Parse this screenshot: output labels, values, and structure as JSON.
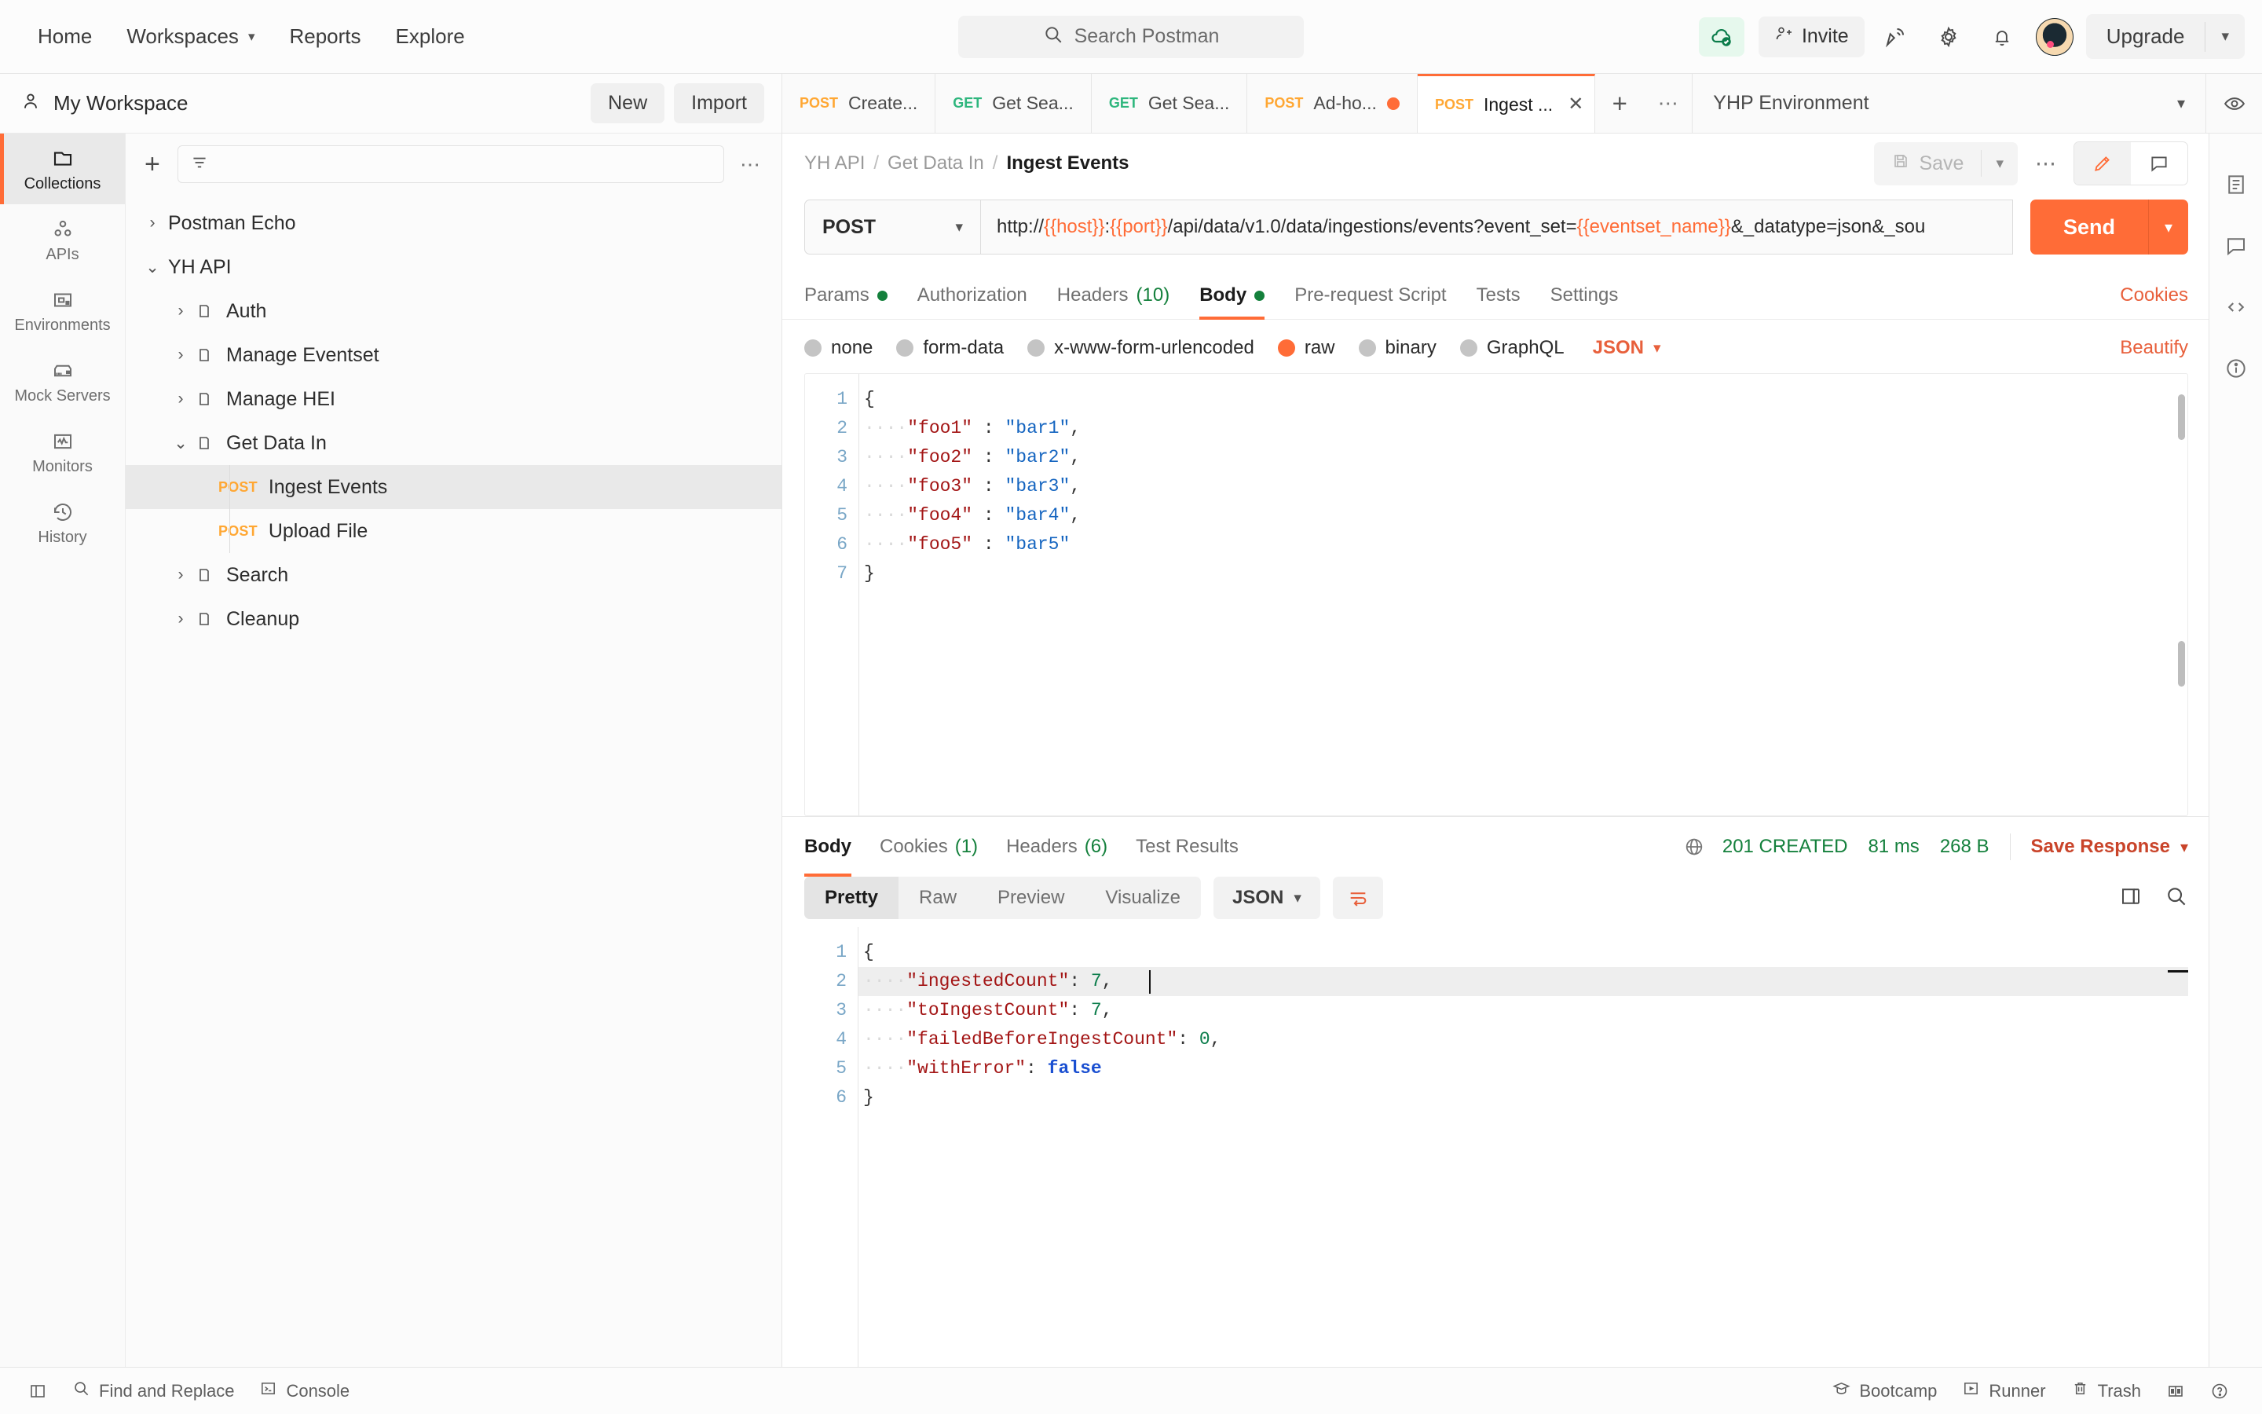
{
  "topbar": {
    "nav": [
      {
        "label": "Home",
        "caret": false
      },
      {
        "label": "Workspaces",
        "caret": true
      },
      {
        "label": "Reports",
        "caret": false
      },
      {
        "label": "Explore",
        "caret": false
      }
    ],
    "search_placeholder": "Search Postman",
    "invite_label": "Invite",
    "upgrade_label": "Upgrade",
    "icons": [
      "cloud-sync-icon",
      "invite-icon",
      "satellite-icon",
      "gear-icon",
      "bell-icon",
      "avatar",
      "chevron-down-icon"
    ]
  },
  "workspace": {
    "name": "My Workspace",
    "new_label": "New",
    "import_label": "Import"
  },
  "rail": {
    "items": [
      {
        "label": "Collections",
        "icon": "folder-icon",
        "active": true
      },
      {
        "label": "APIs",
        "icon": "api-nodes-icon",
        "active": false
      },
      {
        "label": "Environments",
        "icon": "environment-icon",
        "active": false
      },
      {
        "label": "Mock Servers",
        "icon": "mock-server-icon",
        "active": false
      },
      {
        "label": "Monitors",
        "icon": "monitor-pulse-icon",
        "active": false
      },
      {
        "label": "History",
        "icon": "history-clock-icon",
        "active": false
      }
    ]
  },
  "sidebar": {
    "filter_placeholder": "",
    "tree": [
      {
        "label": "Postman Echo",
        "type": "collection",
        "depth": 1,
        "expanded": false,
        "selected": false
      },
      {
        "label": "YH API",
        "type": "collection",
        "depth": 1,
        "expanded": true,
        "selected": false
      },
      {
        "label": "Auth",
        "type": "folder",
        "depth": 2,
        "expanded": false,
        "selected": false
      },
      {
        "label": "Manage Eventset",
        "type": "folder",
        "depth": 2,
        "expanded": false,
        "selected": false
      },
      {
        "label": "Manage HEI",
        "type": "folder",
        "depth": 2,
        "expanded": false,
        "selected": false
      },
      {
        "label": "Get Data In",
        "type": "folder",
        "depth": 2,
        "expanded": true,
        "selected": false
      },
      {
        "label": "Ingest Events",
        "type": "request",
        "method": "POST",
        "depth": 3,
        "selected": true
      },
      {
        "label": "Upload File",
        "type": "request",
        "method": "POST",
        "depth": 3,
        "selected": false
      },
      {
        "label": "Search",
        "type": "folder",
        "depth": 2,
        "expanded": false,
        "selected": false
      },
      {
        "label": "Cleanup",
        "type": "folder",
        "depth": 2,
        "expanded": false,
        "selected": false
      }
    ]
  },
  "tabs": {
    "items": [
      {
        "method": "POST",
        "label": "Create...",
        "active": false,
        "unsaved": false
      },
      {
        "method": "GET",
        "label": "Get Sea...",
        "active": false,
        "unsaved": false
      },
      {
        "method": "GET",
        "label": "Get Sea...",
        "active": false,
        "unsaved": false
      },
      {
        "method": "POST",
        "label": "Ad-ho...",
        "active": false,
        "unsaved": true
      },
      {
        "method": "POST",
        "label": "Ingest ...",
        "active": true,
        "unsaved": false
      }
    ],
    "environment": "YHP Environment"
  },
  "breadcrumb": {
    "parts": [
      "YH API",
      "Get Data In"
    ],
    "current": "Ingest Events",
    "save_label": "Save"
  },
  "request": {
    "method": "POST",
    "url_prefix": "http://",
    "url_parts": [
      {
        "text": "http://",
        "var": false
      },
      {
        "text": "{{host}}",
        "var": true
      },
      {
        "text": ":",
        "var": false
      },
      {
        "text": "{{port}}",
        "var": true
      },
      {
        "text": "/api/data/v1.0/data/ingestions/events?event_set=",
        "var": false
      },
      {
        "text": "{{eventset_name}}",
        "var": true
      },
      {
        "text": "&_datatype=json&_sou",
        "var": false
      }
    ],
    "send_label": "Send",
    "tabs": [
      {
        "label": "Params",
        "dot": true,
        "count": null,
        "active": false
      },
      {
        "label": "Authorization",
        "dot": false,
        "count": null,
        "active": false
      },
      {
        "label": "Headers",
        "dot": false,
        "count": "(10)",
        "active": false
      },
      {
        "label": "Body",
        "dot": true,
        "count": null,
        "active": true
      },
      {
        "label": "Pre-request Script",
        "dot": false,
        "count": null,
        "active": false
      },
      {
        "label": "Tests",
        "dot": false,
        "count": null,
        "active": false
      },
      {
        "label": "Settings",
        "dot": false,
        "count": null,
        "active": false
      }
    ],
    "cookies_label": "Cookies",
    "body_modes": [
      {
        "label": "none",
        "selected": false
      },
      {
        "label": "form-data",
        "selected": false
      },
      {
        "label": "x-www-form-urlencoded",
        "selected": false
      },
      {
        "label": "raw",
        "selected": true
      },
      {
        "label": "binary",
        "selected": false
      },
      {
        "label": "GraphQL",
        "selected": false
      }
    ],
    "body_format": "JSON",
    "beautify_label": "Beautify",
    "body_lines": [
      {
        "n": 1,
        "tokens": [
          {
            "t": "{",
            "c": "p"
          }
        ]
      },
      {
        "n": 2,
        "tokens": [
          {
            "t": "····",
            "c": "ws"
          },
          {
            "t": "\"foo1\"",
            "c": "k"
          },
          {
            "t": " : ",
            "c": "p"
          },
          {
            "t": "\"bar1\"",
            "c": "s"
          },
          {
            "t": ",",
            "c": "p"
          }
        ]
      },
      {
        "n": 3,
        "tokens": [
          {
            "t": "····",
            "c": "ws"
          },
          {
            "t": "\"foo2\"",
            "c": "k"
          },
          {
            "t": " : ",
            "c": "p"
          },
          {
            "t": "\"bar2\"",
            "c": "s"
          },
          {
            "t": ",",
            "c": "p"
          }
        ]
      },
      {
        "n": 4,
        "tokens": [
          {
            "t": "····",
            "c": "ws"
          },
          {
            "t": "\"foo3\"",
            "c": "k"
          },
          {
            "t": " : ",
            "c": "p"
          },
          {
            "t": "\"bar3\"",
            "c": "s"
          },
          {
            "t": ",",
            "c": "p"
          }
        ]
      },
      {
        "n": 5,
        "tokens": [
          {
            "t": "····",
            "c": "ws"
          },
          {
            "t": "\"foo4\"",
            "c": "k"
          },
          {
            "t": " : ",
            "c": "p"
          },
          {
            "t": "\"bar4\"",
            "c": "s"
          },
          {
            "t": ",",
            "c": "p"
          }
        ]
      },
      {
        "n": 6,
        "tokens": [
          {
            "t": "····",
            "c": "ws"
          },
          {
            "t": "\"foo5\"",
            "c": "k"
          },
          {
            "t": " : ",
            "c": "p"
          },
          {
            "t": "\"bar5\"",
            "c": "s"
          }
        ]
      },
      {
        "n": 7,
        "tokens": [
          {
            "t": "}",
            "c": "p"
          }
        ]
      }
    ]
  },
  "response": {
    "tabs": [
      {
        "label": "Body",
        "count": null,
        "active": true
      },
      {
        "label": "Cookies",
        "count": "(1)",
        "active": false
      },
      {
        "label": "Headers",
        "count": "(6)",
        "active": false
      },
      {
        "label": "Test Results",
        "count": null,
        "active": false
      }
    ],
    "status": "201 CREATED",
    "time": "81 ms",
    "size": "268 B",
    "save_response_label": "Save Response",
    "view_modes": [
      {
        "label": "Pretty",
        "active": true
      },
      {
        "label": "Raw",
        "active": false
      },
      {
        "label": "Preview",
        "active": false
      },
      {
        "label": "Visualize",
        "active": false
      }
    ],
    "format": "JSON",
    "body_lines": [
      {
        "n": 1,
        "tokens": [
          {
            "t": "{",
            "c": "p"
          }
        ]
      },
      {
        "n": 2,
        "tokens": [
          {
            "t": "····",
            "c": "ws"
          },
          {
            "t": "\"ingestedCount\"",
            "c": "k"
          },
          {
            "t": ": ",
            "c": "p"
          },
          {
            "t": "7",
            "c": "n"
          },
          {
            "t": ",",
            "c": "p"
          }
        ]
      },
      {
        "n": 3,
        "tokens": [
          {
            "t": "····",
            "c": "ws"
          },
          {
            "t": "\"toIngestCount\"",
            "c": "k"
          },
          {
            "t": ": ",
            "c": "p"
          },
          {
            "t": "7",
            "c": "n"
          },
          {
            "t": ",",
            "c": "p"
          }
        ]
      },
      {
        "n": 4,
        "tokens": [
          {
            "t": "····",
            "c": "ws"
          },
          {
            "t": "\"failedBeforeIngestCount\"",
            "c": "k"
          },
          {
            "t": ": ",
            "c": "p"
          },
          {
            "t": "0",
            "c": "n"
          },
          {
            "t": ",",
            "c": "p"
          }
        ]
      },
      {
        "n": 5,
        "tokens": [
          {
            "t": "····",
            "c": "ws"
          },
          {
            "t": "\"withError\"",
            "c": "k"
          },
          {
            "t": ": ",
            "c": "p"
          },
          {
            "t": "false",
            "c": "b"
          }
        ]
      },
      {
        "n": 6,
        "tokens": [
          {
            "t": "}",
            "c": "p"
          }
        ]
      }
    ]
  },
  "statusbar": {
    "left": [
      {
        "label": "Find and Replace",
        "icon": "search-icon"
      },
      {
        "label": "Console",
        "icon": "console-icon"
      }
    ],
    "right": [
      {
        "label": "Bootcamp",
        "icon": "graduation-cap-icon"
      },
      {
        "label": "Runner",
        "icon": "play-icon"
      },
      {
        "label": "Trash",
        "icon": "trash-icon"
      }
    ]
  },
  "colors": {
    "accent": "#ff6c37",
    "success": "#14803c",
    "method_post": "#ffa733",
    "method_get": "#2eb67d"
  }
}
